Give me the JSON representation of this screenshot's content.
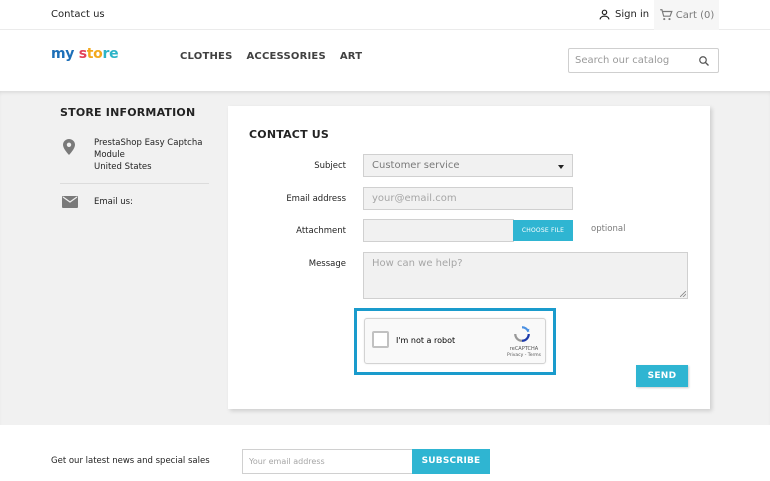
{
  "topbar": {
    "contact_link": "Contact us",
    "signin_label": "Sign in",
    "cart_label": "Cart (0)"
  },
  "header": {
    "logo": {
      "part1": "my",
      "part2": "s",
      "part3": "to",
      "part4": "re"
    },
    "nav": [
      "CLOTHES",
      "ACCESSORIES",
      "ART"
    ],
    "search_placeholder": "Search our catalog"
  },
  "sidebar": {
    "title": "STORE INFORMATION",
    "address_line1": "PrestaShop Easy Captcha",
    "address_line2": "Module",
    "address_line3": "United States",
    "email_label": "Email us:"
  },
  "contact_form": {
    "title": "CONTACT US",
    "subject_label": "Subject",
    "subject_value": "Customer service",
    "email_label": "Email address",
    "email_placeholder": "your@email.com",
    "attachment_label": "Attachment",
    "choose_file": "CHOOSE FILE",
    "optional": "optional",
    "message_label": "Message",
    "message_placeholder": "How can we help?",
    "captcha": {
      "checkbox_label": "I'm not a robot",
      "brand": "reCAPTCHA",
      "links": "Privacy - Terms"
    },
    "send_label": "SEND"
  },
  "footer": {
    "newsletter_text": "Get our latest news and special sales",
    "email_placeholder": "Your email address",
    "subscribe_label": "SUBSCRIBE"
  },
  "colors": {
    "accent": "#2fb5d2",
    "highlight_outline": "#1a9bcc",
    "page_bg": "#f1f1f1"
  }
}
